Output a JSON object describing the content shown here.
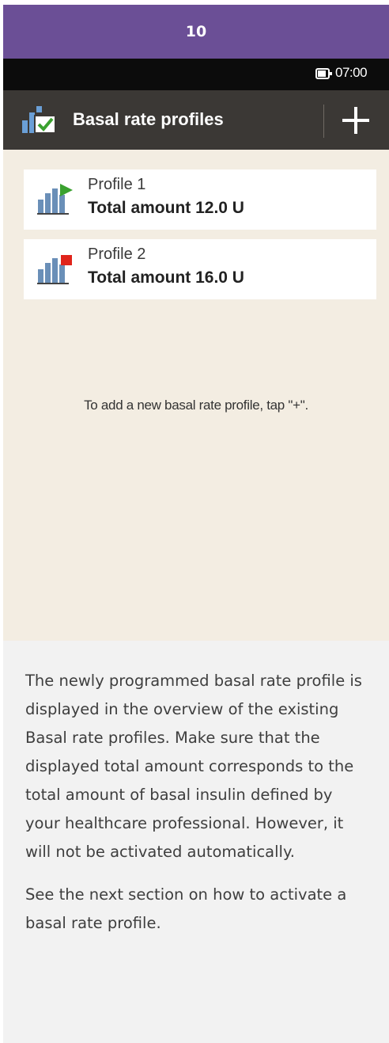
{
  "step": {
    "number": "10"
  },
  "status_bar": {
    "time": "07:00"
  },
  "title_bar": {
    "title": "Basal rate profiles",
    "add_label": "+"
  },
  "profiles": [
    {
      "name": "Profile 1",
      "total": "Total amount 12.0 U",
      "status": "active",
      "flag_color": "#3aa12f"
    },
    {
      "name": "Profile 2",
      "total": "Total amount 16.0 U",
      "status": "inactive",
      "flag_color": "#e0241b"
    }
  ],
  "hint": "To add a new basal rate profile, tap \"+\".",
  "caption": {
    "paragraph_1": "The newly programmed basal rate profile is displayed in the overview of the existing Basal rate profiles. Make sure that the displayed total amount corresponds to the total amount of basal insulin defined by your healthcare professional. However, it will not be activated automatically.",
    "paragraph_2": "See the next section on how to activate a basal rate profile."
  },
  "icons": [
    "battery-icon",
    "basal-profiles-icon",
    "plus-icon",
    "profile-chart-icon"
  ],
  "colors": {
    "step_header": "#6b4f96",
    "status_bar": "#0c0c0c",
    "title_bar": "#3b3835",
    "screen_background": "#f3ede2",
    "caption_background": "#f2f2f2"
  }
}
